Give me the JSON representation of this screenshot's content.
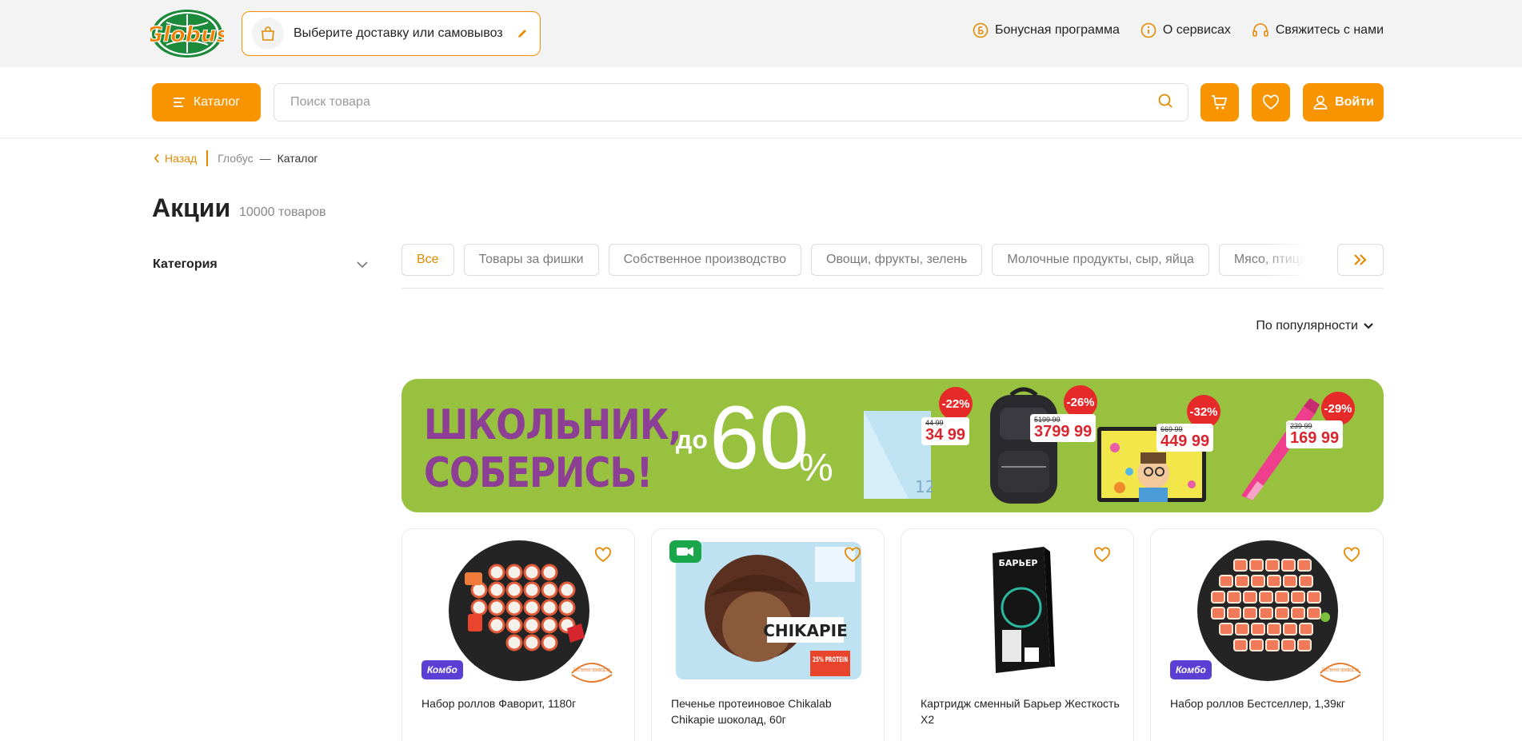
{
  "topbar": {
    "logo_text": "Globus",
    "delivery_label": "Выберите доставку или самовывоз",
    "links": [
      {
        "label": "Бонусная программа",
        "icon": "bonus-coin-icon"
      },
      {
        "label": "О сервисах",
        "icon": "info-icon"
      },
      {
        "label": "Свяжитесь с нами",
        "icon": "headset-icon"
      }
    ]
  },
  "header": {
    "catalog_label": "Каталог",
    "search_placeholder": "Поиск товара",
    "login_label": "Войти"
  },
  "breadcrumb": {
    "back_label": "Назад",
    "items": [
      "Глобус",
      "Каталог"
    ]
  },
  "page": {
    "title": "Акции",
    "count": "10000 товаров"
  },
  "filters": {
    "category_label": "Категория"
  },
  "chips": [
    {
      "label": "Все",
      "active": true
    },
    {
      "label": "Товары за фишки",
      "active": false
    },
    {
      "label": "Собственное производство",
      "active": false
    },
    {
      "label": "Овощи, фрукты, зелень",
      "active": false
    },
    {
      "label": "Молочные продукты, сыр, яйца",
      "active": false
    },
    {
      "label": "Мясо, птица, колбасы",
      "active": false
    }
  ],
  "sort": {
    "label": "По популярности"
  },
  "banner": {
    "title_line1": "ШКОЛЬНИК,",
    "title_line2": "СОБЕРИСЬ!",
    "upto": "до",
    "percent": "60",
    "percent_sign": "%",
    "items": [
      {
        "discount": "-22%",
        "old_price": "44 99",
        "new_price": "34 99"
      },
      {
        "discount": "-26%",
        "old_price": "5199 99",
        "new_price": "3799 99"
      },
      {
        "discount": "-32%",
        "old_price": "669 99",
        "new_price": "449 99"
      },
      {
        "discount": "-29%",
        "old_price": "239 99",
        "new_price": "169 99"
      }
    ],
    "colors": {
      "background": "#98c13f",
      "title": "#8d3f95",
      "badge": "#e62a2a"
    }
  },
  "products": [
    {
      "name": "Набор роллов Фаворит, 1180г",
      "badge": "Комбо",
      "own_production": "Собственное производство"
    },
    {
      "name": "Печенье протеиновое Chikalab Chikapie шоколад, 60г",
      "package_brand": "CHIKAPIE",
      "package_protein": "25% PROTEIN"
    },
    {
      "name": "Картридж сменный Барьер Жесткость Х2",
      "package_brand": "БАРЬЕР"
    },
    {
      "name": "Набор роллов Бестселлер, 1,39кг",
      "badge": "Комбо",
      "own_production": "Собственное производство"
    }
  ],
  "theme": {
    "accent": "#f79400",
    "accent_text": "#e48a00"
  }
}
